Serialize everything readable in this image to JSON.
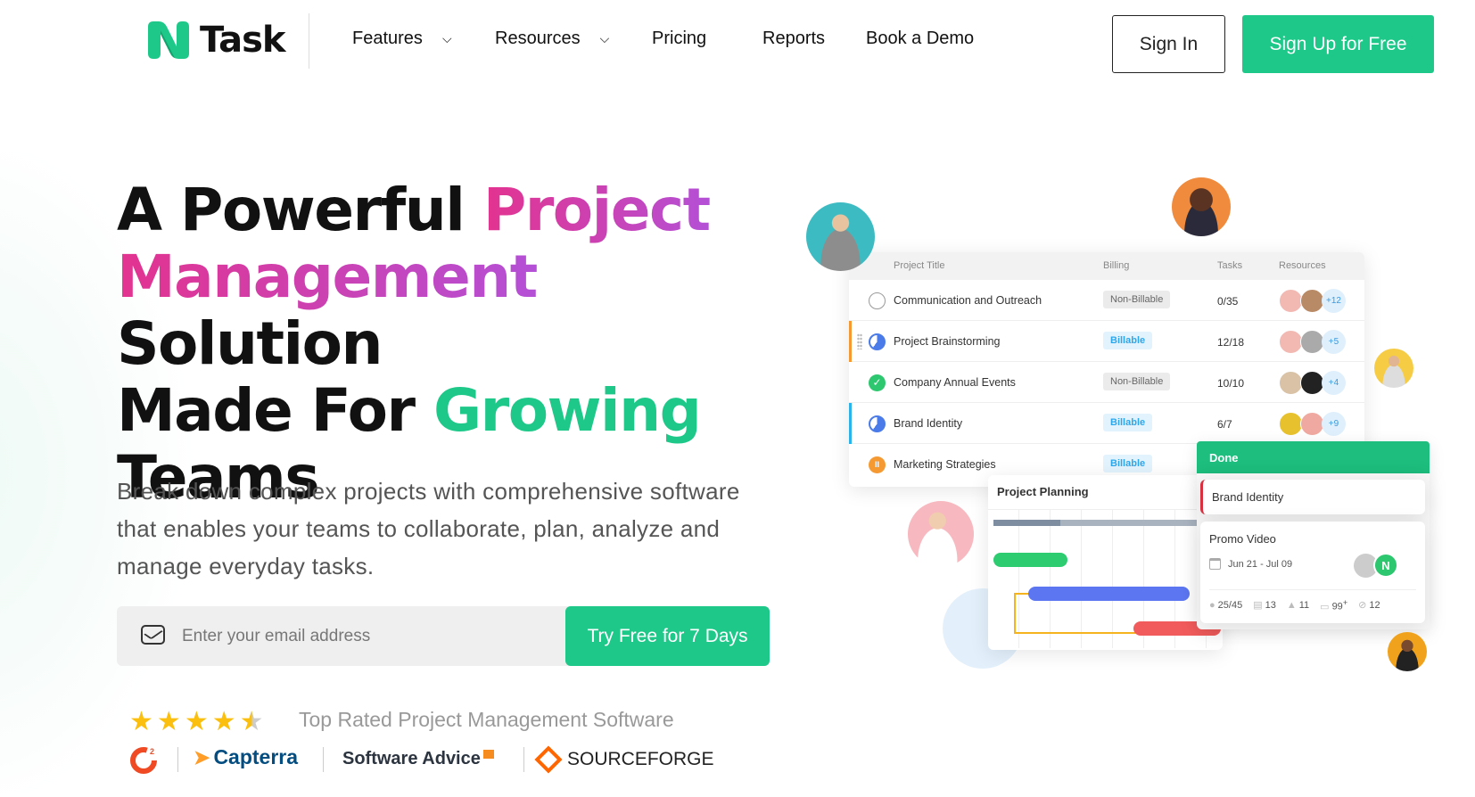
{
  "brand": {
    "name": "Task",
    "accent": "#1dc889"
  },
  "nav": {
    "items": [
      {
        "label": "Features",
        "has_dropdown": true
      },
      {
        "label": "Resources",
        "has_dropdown": true
      },
      {
        "label": "Pricing",
        "has_dropdown": false
      },
      {
        "label": "Reports",
        "has_dropdown": false
      },
      {
        "label": "Book a Demo",
        "has_dropdown": false
      }
    ],
    "sign_in": "Sign In",
    "sign_up": "Sign Up for Free"
  },
  "hero": {
    "title_parts": [
      "A Powerful ",
      "Project",
      "Management",
      " Solution",
      "Made For ",
      "Growing",
      "Teams"
    ],
    "description": "Break down complex projects with comprehensive software that enables your teams to collaborate, plan, analyze and manage everyday tasks.",
    "email_placeholder": "Enter your email address",
    "cta": "Try Free for 7 Days",
    "rating": 4.5,
    "rating_text": "Top Rated Project Management Software",
    "review_sites": [
      "G2",
      "Capterra",
      "Software Advice",
      "SOURCEFORGE"
    ]
  },
  "table": {
    "headers": [
      "Project Title",
      "Billing",
      "Tasks",
      "Resources"
    ],
    "rows": [
      {
        "title": "Communication and Outreach",
        "billing": "Non-Billable",
        "tasks": "0/35",
        "more": "+12",
        "status": "not-started"
      },
      {
        "title": "Project Brainstorming",
        "billing": "Billable",
        "tasks": "12/18",
        "more": "+5",
        "status": "in-progress"
      },
      {
        "title": "Company Annual Events",
        "billing": "Non-Billable",
        "tasks": "10/10",
        "more": "+4",
        "status": "done"
      },
      {
        "title": "Brand Identity",
        "billing": "Billable",
        "tasks": "6/7",
        "more": "+9",
        "status": "in-progress"
      },
      {
        "title": "Marketing Strategies",
        "billing": "Billable",
        "tasks": "",
        "more": "",
        "status": "paused"
      }
    ]
  },
  "planning": {
    "title": "Project Planning"
  },
  "board": {
    "column": "Done",
    "card1": "Brand Identity",
    "card2": {
      "title": "Promo Video",
      "dates": "Jun 21 - Jul 09",
      "avatar_initial": "N",
      "stats": {
        "checklist": "25/45",
        "subtasks": "13",
        "issues": "11",
        "comments": "99",
        "comments_sup": "+",
        "attachments": "12"
      }
    }
  }
}
